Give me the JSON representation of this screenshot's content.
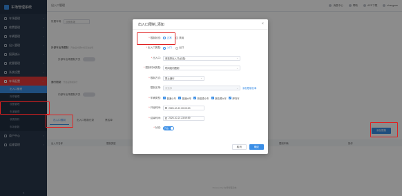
{
  "app": {
    "title": "车场管理系统"
  },
  "breadcrumb": "出入口管理",
  "topbar": {
    "items": [
      "消息中心",
      "帮助",
      "APP下载",
      "zhangsan"
    ]
  },
  "sidebar": {
    "items": [
      {
        "label": "车场管理"
      },
      {
        "label": "收费管理"
      },
      {
        "label": "车辆管理"
      },
      {
        "label": "出入管理"
      },
      {
        "label": "报表统计"
      },
      {
        "label": "优惠管理"
      },
      {
        "label": "系统设置"
      },
      {
        "label": "车场配置",
        "active": true
      }
    ],
    "sub_items": [
      {
        "label": "出入口管理",
        "active": true
      },
      {
        "label": "岗亭管理"
      },
      {
        "label": "设备管理"
      },
      {
        "label": "车道管理"
      },
      {
        "label": "收费规则"
      },
      {
        "label": "车场参数"
      }
    ],
    "items_after": [
      {
        "label": "商户中心"
      },
      {
        "label": "运维管理"
      }
    ],
    "collapse": "«"
  },
  "main": {
    "select_label": "所属车场",
    "select_value": "示例车场",
    "section1": {
      "title": "外部车出场限制",
      "note": "开启后外部车将无法出场"
    },
    "row1_label": "外部车出场限制开关",
    "section2": {
      "title": "通行限制",
      "note": "开启后限制通行"
    },
    "row2_label": "内部车出场限制开关",
    "tabs": [
      "出入口限制",
      "出入口限制记录",
      "黑名单"
    ],
    "add_button": "添加限制",
    "table_headers": [
      "出入口名称",
      "限制类型",
      "开始时间",
      "结束时间",
      "限制车辆",
      "操作"
    ],
    "footer": "Powered by 车场管理系统"
  },
  "modal": {
    "title": "出入口限制_添加",
    "close": "×",
    "fields": {
      "limit_mode": {
        "label": "限制状态:",
        "options": [
          "正常",
          "禁用"
        ],
        "selected": "正常"
      },
      "io_type": {
        "label": "出入口类型:",
        "options": [
          "入口",
          "出口"
        ],
        "selected": "入口"
      },
      "io_name": {
        "label": "出入口:",
        "value": "请选择出入口(必选)"
      },
      "limit_type": {
        "label": "限制时间类型:",
        "value": "时间段内限制"
      },
      "limit_rule": {
        "label": "限制方式:",
        "value": "禁止通行"
      },
      "blacklist": {
        "label": "限制名单:",
        "value": "请选择",
        "link": "添加限制名单"
      },
      "vehicle_types": {
        "label": "车辆类型:",
        "options": [
          "普通小车",
          "普通大车",
          "新能源小车",
          "新能源大车",
          "摩托车"
        ]
      },
      "start_time": {
        "label": "开始时间:",
        "value": "2020-10-21 00:00:00"
      },
      "end_time": {
        "label": "结束时间:",
        "value": "2020-10-21 23:59:59"
      },
      "status": {
        "label": "状态:",
        "value": "开启"
      }
    },
    "cancel": "取消",
    "confirm": "确定"
  },
  "colors": {
    "primary": "#3a8ee6",
    "highlight": "#e02020",
    "sidebar": "#2b3a4e"
  }
}
